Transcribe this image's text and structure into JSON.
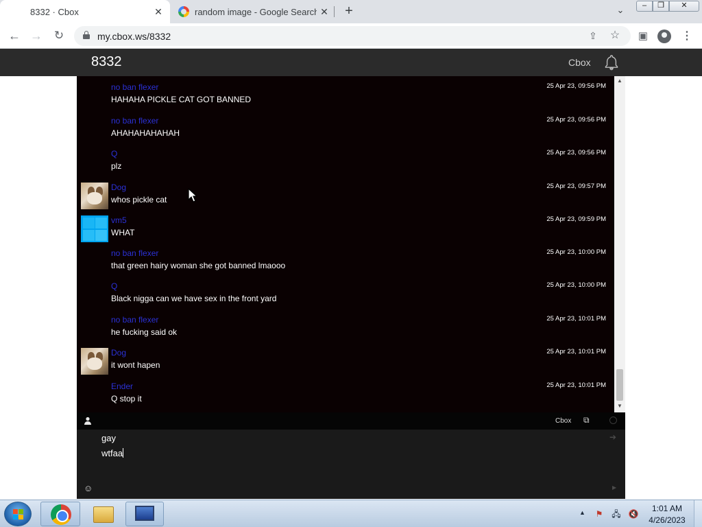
{
  "browser": {
    "tabs": [
      {
        "title": "8332 · Cbox",
        "active": true
      },
      {
        "title": "random image - Google Search",
        "active": false
      }
    ],
    "url": "my.cbox.ws/8332"
  },
  "header": {
    "title": "8332",
    "link": "Cbox"
  },
  "messages": [
    {
      "name": "no ban flexer",
      "text": "HAHAHA PICKLE CAT GOT BANNED",
      "time": "25 Apr 23, 09:56 PM",
      "avatar": "none"
    },
    {
      "name": "no ban flexer",
      "text": "AHAHAHAHAHAH",
      "time": "25 Apr 23, 09:56 PM",
      "avatar": "none"
    },
    {
      "name": "Q",
      "text": "plz",
      "time": "25 Apr 23, 09:56 PM",
      "avatar": "none"
    },
    {
      "name": "Dog",
      "text": "whos pickle cat",
      "time": "25 Apr 23, 09:57 PM",
      "avatar": "dog"
    },
    {
      "name": "vm5",
      "text": "WHAT",
      "time": "25 Apr 23, 09:59 PM",
      "avatar": "windows"
    },
    {
      "name": "no ban flexer",
      "text": "that green hairy woman she got banned lmaooo",
      "time": "25 Apr 23, 10:00 PM",
      "avatar": "none"
    },
    {
      "name": "Q",
      "text": "Black nigga can we have sex in the front yard",
      "time": "25 Apr 23, 10:00 PM",
      "avatar": "none"
    },
    {
      "name": "no ban flexer",
      "text": "he fucking said ok",
      "time": "25 Apr 23, 10:01 PM",
      "avatar": "none"
    },
    {
      "name": "Dog",
      "text": "it wont hapen",
      "time": "25 Apr 23, 10:01 PM",
      "avatar": "dog"
    },
    {
      "name": "Ender",
      "text": "Q stop it",
      "time": "25 Apr 23, 10:01 PM",
      "avatar": "none"
    }
  ],
  "chat_bar": {
    "link": "Cbox"
  },
  "input": {
    "lines": [
      "gay",
      "wtfaa"
    ]
  },
  "taskbar": {
    "time": "1:01 AM",
    "date": "4/26/2023"
  },
  "icons": {
    "tab_close": "close-icon",
    "new_tab": "plus-icon",
    "back": "arrow-left-icon",
    "forward": "arrow-right-icon",
    "reload": "reload-icon",
    "lock": "lock-icon",
    "share": "share-icon",
    "bookmark": "star-icon",
    "side_panel": "side-panel-icon",
    "profile": "profile-icon",
    "menu": "kebab-menu-icon",
    "bell": "bell-icon",
    "user": "user-icon",
    "popout": "popout-icon",
    "emoji": "smiley-icon",
    "send": "send-icon"
  },
  "colors": {
    "chat_bg": "#0a0102",
    "name_color": "#2b31d6",
    "header_bg": "#2b2b2b",
    "input_bg": "#1a1a1a"
  }
}
